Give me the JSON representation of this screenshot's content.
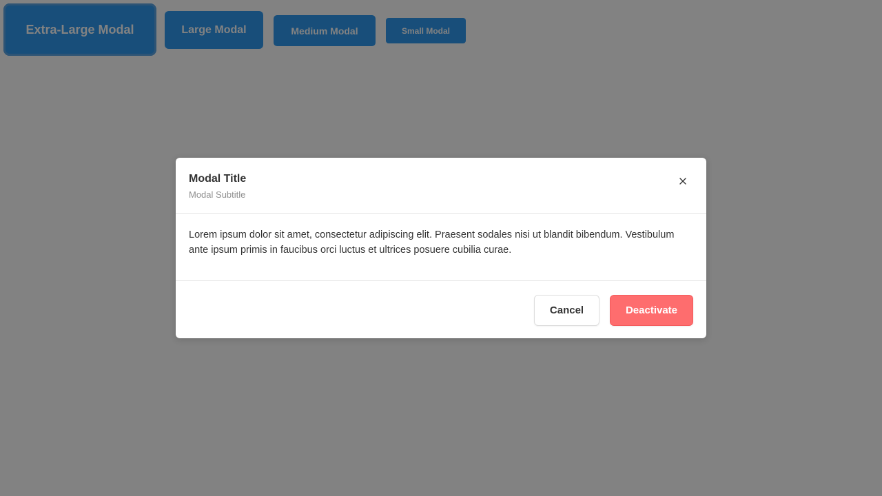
{
  "launchers": {
    "xl_label": "Extra-Large Modal",
    "lg_label": "Large Modal",
    "md_label": "Medium Modal",
    "sm_label": "Small Modal"
  },
  "modal": {
    "title": "Modal Title",
    "subtitle": "Modal Subtitle",
    "close_icon": "close-icon",
    "body": "Lorem ipsum dolor sit amet, consectetur adipiscing elit. Praesent sodales nisi ut blandit bibendum. Vestibulum ante ipsum primis in faucibus orci luctus et ultrices posuere cubilia curae.",
    "cancel_label": "Cancel",
    "deactivate_label": "Deactivate"
  },
  "colors": {
    "primary": "#2f99f0",
    "danger": "#fe6d6e",
    "overlay": "rgba(0,0,0,0.49)"
  }
}
